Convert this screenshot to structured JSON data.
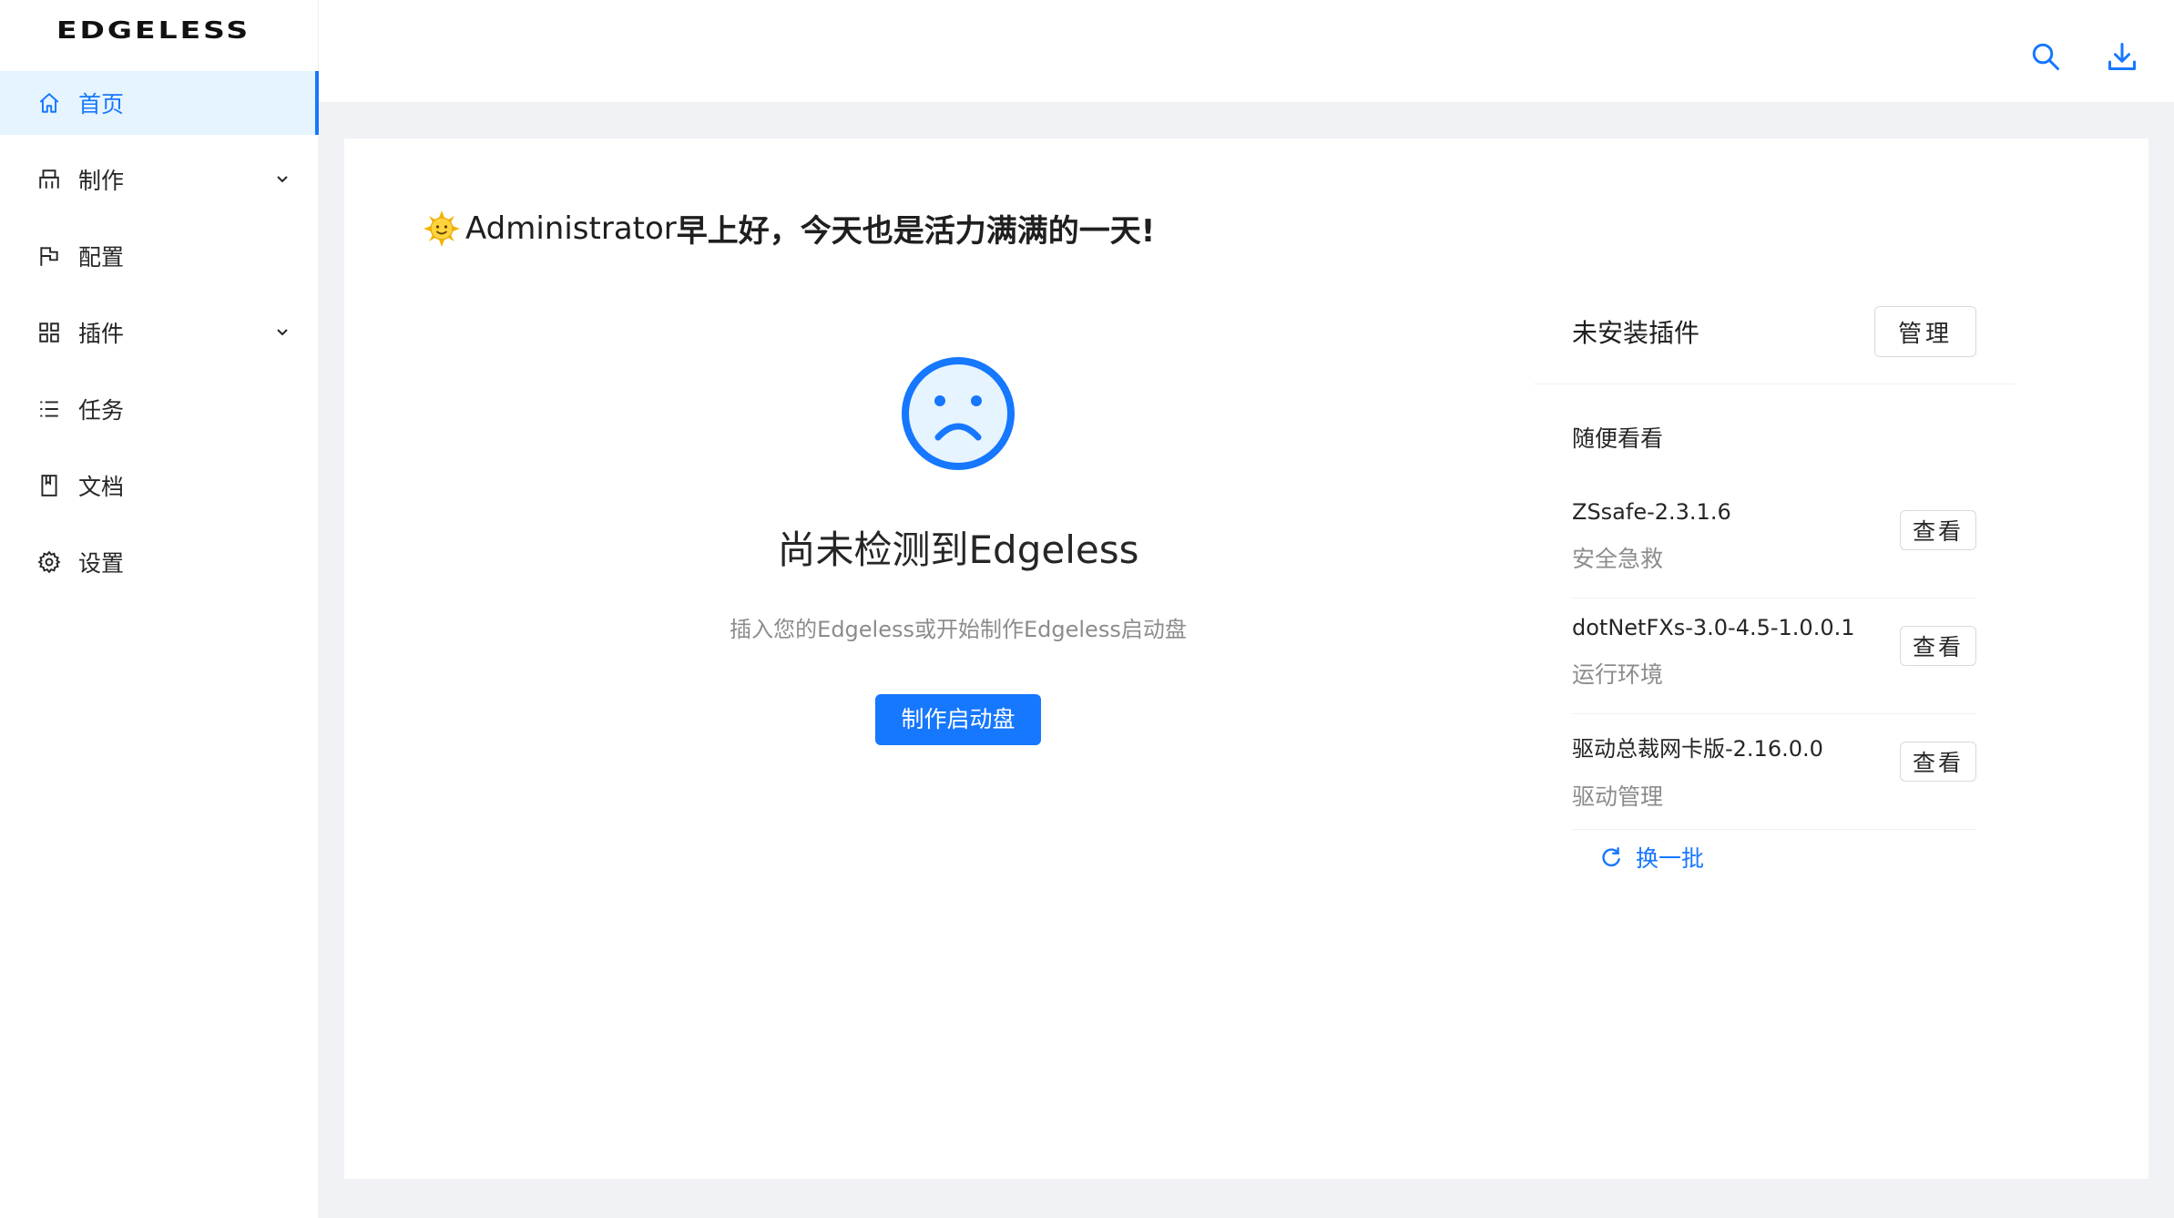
{
  "app": {
    "logo_text": "EDGELESS"
  },
  "colors": {
    "accent": "#1677ff",
    "active_bg": "#e6f4ff",
    "content_bg": "#f0f2f5"
  },
  "sidebar": {
    "items": [
      {
        "label": "首页",
        "icon": "home-icon",
        "active": true
      },
      {
        "label": "制作",
        "icon": "build-icon",
        "expandable": true
      },
      {
        "label": "配置",
        "icon": "flag-icon"
      },
      {
        "label": "插件",
        "icon": "grid-icon",
        "expandable": true
      },
      {
        "label": "任务",
        "icon": "list-icon"
      },
      {
        "label": "文档",
        "icon": "book-icon"
      },
      {
        "label": "设置",
        "icon": "gear-icon"
      }
    ]
  },
  "header": {
    "icons": [
      "search-icon",
      "download-icon"
    ]
  },
  "main": {
    "greeting_name": "Administrator",
    "greeting_text": "早上好，今天也是活力满满的一天!",
    "empty": {
      "title": "尚未检测到Edgeless",
      "subtitle": "插入您的Edgeless或开始制作Edgeless启动盘",
      "button_label": "制作启动盘"
    }
  },
  "panel": {
    "title": "未安装插件",
    "manage_label": "管理",
    "subtitle": "随便看看",
    "plugins": [
      {
        "name": "ZSsafe-2.3.1.6",
        "category": "安全急救",
        "button": "查看"
      },
      {
        "name": "dotNetFXs-3.0-4.5-1.0.0.1",
        "category": "运行环境",
        "button": "查看"
      },
      {
        "name": "驱动总裁网卡版-2.16.0.0",
        "category": "驱动管理",
        "button": "查看"
      }
    ],
    "refresh_label": "换一批"
  }
}
